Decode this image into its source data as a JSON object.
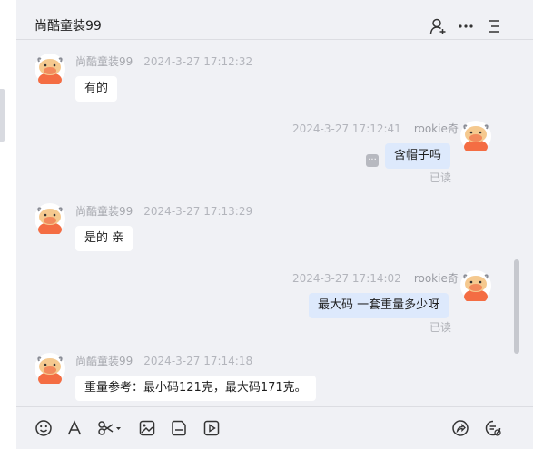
{
  "header": {
    "title": "尚酷童装99",
    "icons": [
      "add-person-icon",
      "more-icon",
      "list-icon"
    ]
  },
  "messages": [
    {
      "side": "left",
      "name": "尚酷童装99",
      "time": "2024-3-27 17:12:32",
      "text": "有的",
      "avatar": "cartoon-cow-avatar"
    },
    {
      "side": "right",
      "name": "rookie奇",
      "time": "2024-3-27 17:12:41",
      "text": "含帽子吗",
      "status": "已读",
      "avatar": "cartoon-cow-avatar"
    },
    {
      "side": "left",
      "name": "尚酷童装99",
      "time": "2024-3-27 17:13:29",
      "text": "是的 亲",
      "avatar": "cartoon-cow-avatar"
    },
    {
      "side": "right",
      "name": "rookie奇",
      "time": "2024-3-27 17:14:02",
      "text": "最大码 一套重量多少呀",
      "status": "已读",
      "avatar": "cartoon-cow-avatar"
    },
    {
      "side": "left",
      "name": "尚酷童装99",
      "time": "2024-3-27 17:14:18",
      "text": "重量参考：最小码121克，最大码171克。",
      "avatar": "cartoon-cow-avatar"
    }
  ],
  "toolbar": {
    "icons": [
      "emoji-icon",
      "font-icon",
      "scissors-icon",
      "image-icon",
      "file-icon",
      "video-icon",
      "share-icon",
      "chat-history-icon"
    ]
  },
  "colors": {
    "bubble_mine": "#dde9fc",
    "bubble_other": "#ffffff",
    "background": "#f0f1f5"
  }
}
